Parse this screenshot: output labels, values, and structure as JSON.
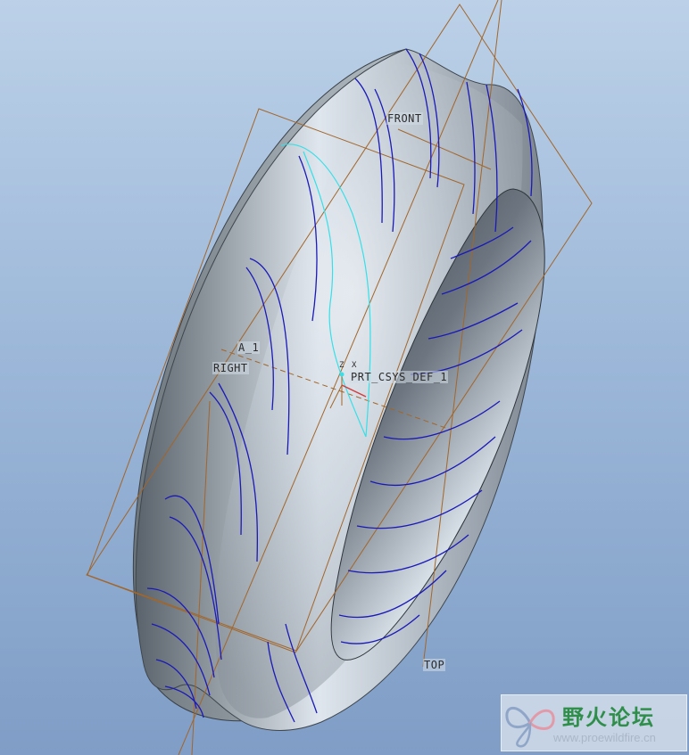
{
  "viewport": {
    "background_top": "#bcd1e8",
    "background_bottom": "#7f9dc6"
  },
  "datums": {
    "front": "FRONT",
    "right": "RIGHT",
    "top": "TOP",
    "axis": "A_1",
    "csys": "PRT_CSYS_DEF_1",
    "csys_z": "Z",
    "csys_x": "X"
  },
  "colors": {
    "datum_plane": "#a2662a",
    "curve": "#1a1ab8",
    "selected_curve": "#35e0e8",
    "model_light": "#eef3f8",
    "model_dark": "#4e565e"
  },
  "watermark": {
    "title": "野火论坛",
    "url": "www.proewildfire.cn",
    "logo": "butterfly-logo"
  }
}
